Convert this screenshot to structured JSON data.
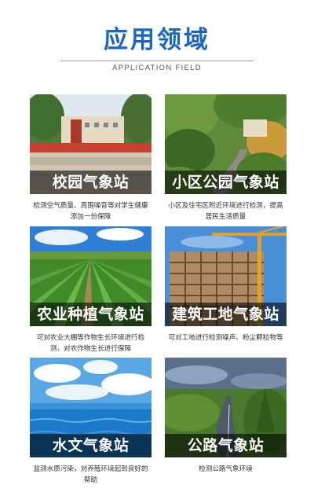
{
  "header": {
    "title": "应用领域",
    "subtitle": "APPLICATION FIELD"
  },
  "cards": [
    {
      "label": "校园气象站",
      "description": "检测空气质量、周围噪音等对学生健康添加一份保障",
      "image": "campus-photo"
    },
    {
      "label": "小区公园气象站",
      "description": "小区及住宅区附近环境进行检测，提高居民生活质量",
      "image": "park-photo"
    },
    {
      "label": "农业种植气象站",
      "description": "可对农业大棚等作物生长环境进行检测，对农作物生长进行保障",
      "image": "farmland-photo"
    },
    {
      "label": "建筑工地气象站",
      "description": "可对工地进行检测噪声、粉尘颗粒物等",
      "image": "construction-site-photo"
    },
    {
      "label": "水文气象站",
      "description": "监测水质污染，对养殖环境起到良好的帮助",
      "image": "ocean-photo"
    },
    {
      "label": "公路气象站",
      "description": "检测公路气象环境",
      "image": "highway-photo"
    }
  ],
  "colors": {
    "title": "#1667c6",
    "label_bar": "rgba(0,0,0,0.58)",
    "label_text": "#ffffff"
  }
}
